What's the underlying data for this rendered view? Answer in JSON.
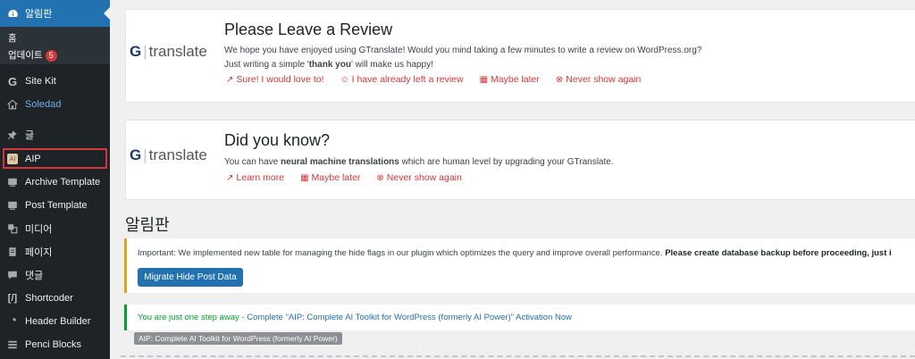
{
  "sidebar": {
    "dashboard": "알림판",
    "submenu": {
      "home": "홈",
      "updates": "업데이트",
      "updates_count": "5"
    },
    "items": [
      {
        "label": "Site Kit",
        "icon": "g-icon"
      },
      {
        "label": "Soledad",
        "icon": "home-icon"
      },
      {
        "label": "글",
        "icon": "pin-icon"
      },
      {
        "label": "AIP",
        "icon": "aip-icon"
      },
      {
        "label": "Archive Template",
        "icon": "template-icon"
      },
      {
        "label": "Post Template",
        "icon": "template-icon"
      },
      {
        "label": "미디어",
        "icon": "media-icon"
      },
      {
        "label": "페이지",
        "icon": "page-icon"
      },
      {
        "label": "댓글",
        "icon": "comment-icon"
      },
      {
        "label": "Shortcoder",
        "icon": "shortcode-icon"
      },
      {
        "label": "Header Builder",
        "icon": "tools-icon"
      },
      {
        "label": "Penci Blocks",
        "icon": "blocks-icon"
      }
    ]
  },
  "review_notice": {
    "logo_g": "G",
    "logo_text": "translate",
    "title": "Please Leave a Review",
    "text1": "We hope you have enjoyed using GTranslate! Would you mind taking a few minutes to write a review on WordPress.org?",
    "text2_pre": "Just writing a simple '",
    "text2_bold": "thank you",
    "text2_post": "' will make us happy!",
    "links": [
      "Sure! I would love to!",
      "I have already left a review",
      "Maybe later",
      "Never show again"
    ]
  },
  "didyouknow_notice": {
    "logo_g": "G",
    "logo_text": "translate",
    "title": "Did you know?",
    "text_pre": "You can have ",
    "text_bold": "neural machine translations",
    "text_post": " which are human level by upgrading your GTranslate.",
    "links": [
      "Learn more",
      "Maybe later",
      "Never show again"
    ]
  },
  "page_title": "알림판",
  "warning_notice": {
    "text": "Important: We implemented new table for managing the hide flags in our plugin which optimizes the query and improve overall performance. ",
    "text_bold": "Please create database backup before proceeding, just i",
    "button": "Migrate Hide Post Data"
  },
  "success_notice": {
    "text": "You are just one step away - ",
    "link": "Complete \"AIP: Complete AI Toolkit for WordPress (formerly AI Power)\" Activation Now",
    "tag": "AIP: Complete AI Toolkit for WordPress (formerly AI Power)"
  },
  "colors": {
    "accent": "#2271b1",
    "sidebar": "#1d2327",
    "danger": "#d63638",
    "success": "#00a32a",
    "warning": "#dba617"
  }
}
